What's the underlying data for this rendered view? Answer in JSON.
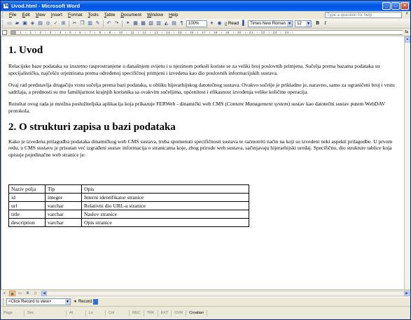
{
  "window": {
    "title": "Uvod.html - Microsoft Word",
    "minimize": "_",
    "maximize": "□",
    "close": "×"
  },
  "menubar": {
    "items": [
      "File",
      "Edit",
      "View",
      "Insert",
      "Format",
      "Tools",
      "Table",
      "Document",
      "Window",
      "Help"
    ],
    "ask_placeholder": "Type a question for help",
    "close_doc": "×"
  },
  "toolbar": {
    "zoom": "100%",
    "read_label": "Read",
    "font": "Times New Roman",
    "size": "12",
    "bold": "B",
    "italic": "I"
  },
  "ruler": {
    "ticks": "· 1 · ı · 1 · ı · 2 · ı · 3 · ı · 4 · ı · 5 · ı · 6 · ı · 7 · ı · 8 · ı · 9 · ı · 10 · ı · 11 · ı · 12 · ı · 13 · ı · 14 · ı · 15 · ı · 16 · ı · 17 · ı · 18 · ı · 19 · ı · 20 · ı · 21 · ı · 22 · ı · 23 · ı · 24 · ı"
  },
  "document": {
    "heading1": "1. Uvod",
    "p1": "Relacijske baze podataka su izuzetno rasprostranjene u današnjem svijetu i u njezinom potkoli koriste se za veliki broj poslovnih primjena. Sučelja prema bazama podataka su specijalistička, najčešće orjentirana prema određenoj specifičnoj primjeni i izvedena kao dio poslovnih informacijskih sustava.",
    "p2": "Ovaj rad predstavlja drugačiju vrstu sučelja prema bazi podataka, u obliku hijerarhijskog datotečnog sustava. Ovakvo sučelje je prikladno je, naravno, samo za ograničeni broj i vrstu sadržaja, a prednosti su mu familijarnost krajnjih korisnika sa ovakvim sučeljima, općenitost i efikasnost izvođenja velike količine operacija.",
    "p3_before": "Rezultat ovog rada je mrežna poslužiteljska aplikacija koja prikazuje FERWeb - dinamički web CMS (",
    "p3_em": "Content Management system",
    "p3_after": ") sustav kao datotečni sustav putem WebDAV protokola.",
    "heading2": "2. O strukturi zapisa u bazi podataka",
    "p4": "Kako je izvedena prilagodba podataka dinamičkog web CMS sustava, treba spomenuti specifičnosti sustava te razmotriti način na koji su izvedeni neki aspekti prilagodbe. U prvom redu, u CMS sustavu je prisutan već izgrađeni sustav informacija o stranicama koje, zbog prirode web sustava, sačinjavaju hijerarhijski uređaj. Specifično, dio strukture tablice koja opisuje pojedinačne web stranice je:",
    "table": [
      [
        "Naziv polja",
        "Tip",
        "Opis"
      ],
      [
        "id",
        "integer",
        "Interni identifikator stranice"
      ],
      [
        "url",
        "varchar",
        "Relativni dio URL-a stranice"
      ],
      [
        "title",
        "varchar",
        "Naslov stranice"
      ],
      [
        "description",
        "varchar",
        "Opis stranice"
      ]
    ]
  },
  "browsebar": {
    "record_label": "<Click Record to view>",
    "record_button": "Record"
  },
  "statusbar": {
    "page": "Page",
    "sec": "Sec",
    "at": "At",
    "ln": "Ln",
    "col": "Col",
    "rec": "REC",
    "trk": "TRK",
    "ext": "EXT",
    "ovr": "OVR",
    "lang": "Croatian"
  }
}
